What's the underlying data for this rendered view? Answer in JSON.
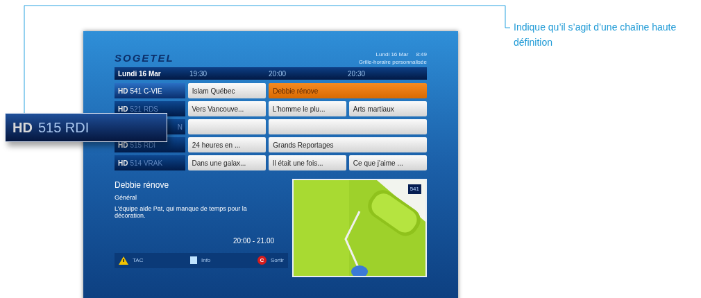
{
  "callout": {
    "text": "Indique qu’il s’agit d’une chaîne haute définition"
  },
  "magnifier": {
    "hd": "HD",
    "channel": "515 RDI"
  },
  "guide": {
    "logo": "SOGETEL",
    "date_time": "Lundi 16 Mar     8:49",
    "subtitle": "Grille-horaire personnalisée",
    "header": {
      "date": "Lundi 16 Mar",
      "times": [
        "19:30",
        "20:00",
        "20:30"
      ]
    },
    "rows": [
      {
        "hd": "HD",
        "channel": "541 C-VIE",
        "selected": true,
        "programs": [
          {
            "title": "Islam Québec",
            "wide": false,
            "selected": false
          },
          {
            "title": "Debbie rénove",
            "wide": true,
            "selected": true
          }
        ]
      },
      {
        "hd": "HD",
        "channel": "521 RDS",
        "selected": false,
        "programs": [
          {
            "title": "Vers Vancouve...",
            "wide": false,
            "selected": false
          },
          {
            "title": "L'homme le plu...",
            "wide": false,
            "selected": false
          },
          {
            "title": "Arts martiaux",
            "wide": false,
            "selected": false
          }
        ]
      },
      {
        "channel": "N",
        "selected": false,
        "programs": [
          {
            "wide": false,
            "selected": false
          },
          {
            "wide": true,
            "selected": false
          }
        ]
      },
      {
        "hd": "HD",
        "channel": "515 RDI",
        "selected": false,
        "programs": [
          {
            "title": "24 heures en ...",
            "wide": false,
            "selected": false
          },
          {
            "title": "Grands Reportages",
            "wide": true,
            "selected": false
          }
        ]
      },
      {
        "hd": "HD",
        "channel": "514 VRAK",
        "selected": false,
        "programs": [
          {
            "title": "Dans une galax...",
            "wide": false,
            "selected": false
          },
          {
            "title": "Il était une fois...",
            "wide": false,
            "selected": false
          },
          {
            "title": "Ce que j'aime ...",
            "wide": false,
            "selected": false
          }
        ]
      }
    ],
    "info": {
      "title": "Debbie rénove",
      "genre": "Général",
      "description": "L'équipe aide Pat, qui manque de temps pour la décoration.",
      "time": "20:00 - 21.00",
      "channel_badge": "541"
    },
    "footer": [
      {
        "kind": "triangle",
        "label": "TAC"
      },
      {
        "kind": "square",
        "label": "Info"
      },
      {
        "kind": "circle",
        "label": "Sortir",
        "key": "C"
      }
    ]
  }
}
